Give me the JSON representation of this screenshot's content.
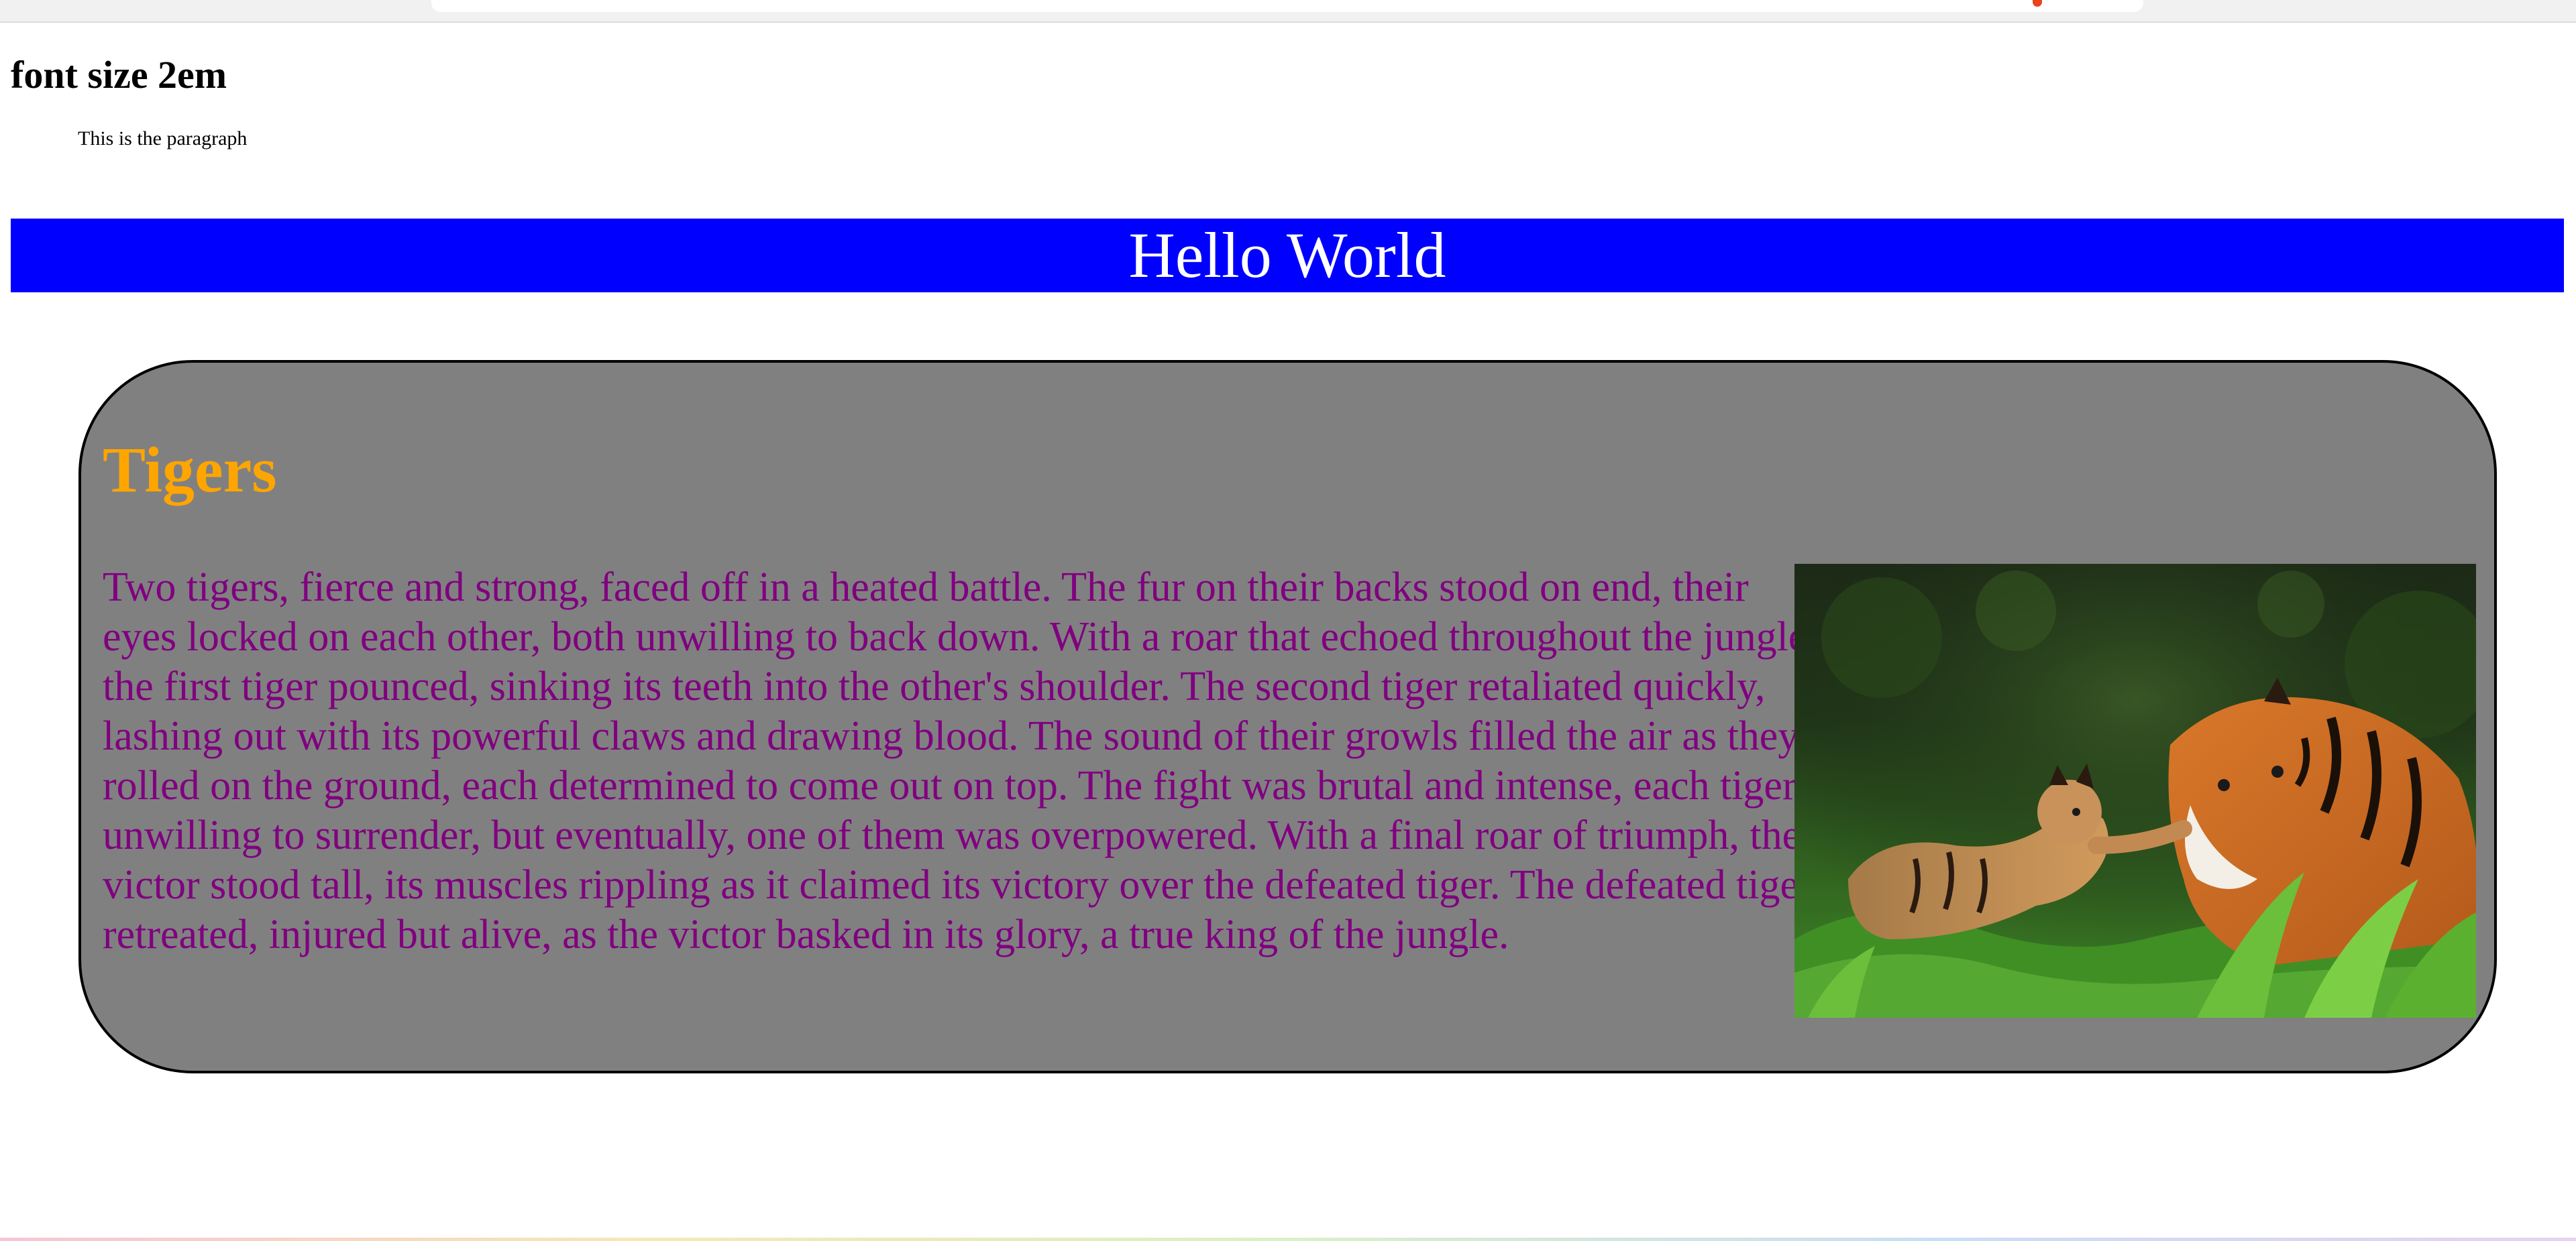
{
  "heading": {
    "text": "font size 2em"
  },
  "paragraph": {
    "text": "This is the paragraph"
  },
  "banner": {
    "title": "Hello World",
    "background_color": "#0000ff",
    "text_color": "#ffffff"
  },
  "card": {
    "title": "Tigers",
    "title_color": "#ffa500",
    "text_color": "#800080",
    "background_color": "#808080",
    "text": "Two tigers, fierce and strong, faced off in a heated battle. The fur on their backs stood on end, their eyes locked on each other, both unwilling to back down. With a roar that echoed throughout the jungle, the first tiger pounced, sinking its teeth into the other's shoulder. The second tiger retaliated quickly, lashing out with its powerful claws and drawing blood. The sound of their growls filled the air as they rolled on the ground, each determined to come out on top. The fight was brutal and intense, each tiger unwilling to surrender, but eventually, one of them was overpowered. With a final roar of triumph, the victor stood tall, its muscles rippling as it claimed its victory over the defeated tiger. The defeated tiger retreated, injured but alive, as the victor basked in its glory, a true king of the jungle.",
    "image_icon": "tiger-photo"
  }
}
